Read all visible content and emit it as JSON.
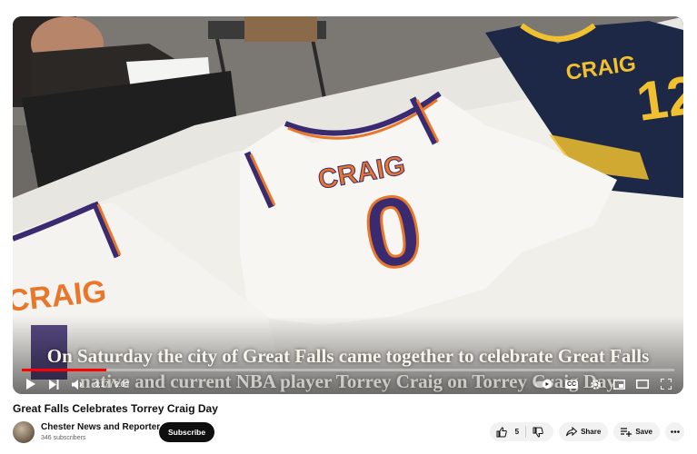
{
  "video": {
    "caption_line1": "On Saturday the city of Great Falls came together to celebrate Great Falls",
    "caption_line2": "native and current NBA player Torrey Craig on Torrey Craig Day",
    "jersey_name": "CRAIG",
    "jersey_number_front": "0",
    "jersey_number_back": "12",
    "time_current": "0:17",
    "time_total": "2:09",
    "progress": 0.13
  },
  "info": {
    "title": "Great Falls Celebrates Torrey Craig Day",
    "channel_name": "Chester News and Reporter",
    "subscribers": "346 subscribers",
    "subscribe_label": "Subscribe",
    "like_count": "5",
    "share_label": "Share",
    "save_label": "Save"
  },
  "icons": {
    "play": "play-icon",
    "next": "next-icon",
    "volume": "volume-icon",
    "autoplay": "autoplay-toggle-icon",
    "cc": "captions-icon",
    "settings": "gear-icon",
    "miniplayer": "miniplayer-icon",
    "theater": "theater-icon",
    "fullscreen": "fullscreen-icon",
    "like": "thumbs-up-icon",
    "dislike": "thumbs-down-icon",
    "share": "share-icon",
    "save": "playlist-add-icon",
    "more": "more-icon"
  },
  "colors": {
    "progress": "#ff0000",
    "subscribe_bg": "#0f0f0f",
    "jersey_orange": "#e8762b",
    "jersey_purple": "#3a2a70",
    "pacers_navy": "#1d2846",
    "pacers_gold": "#f0c030"
  }
}
